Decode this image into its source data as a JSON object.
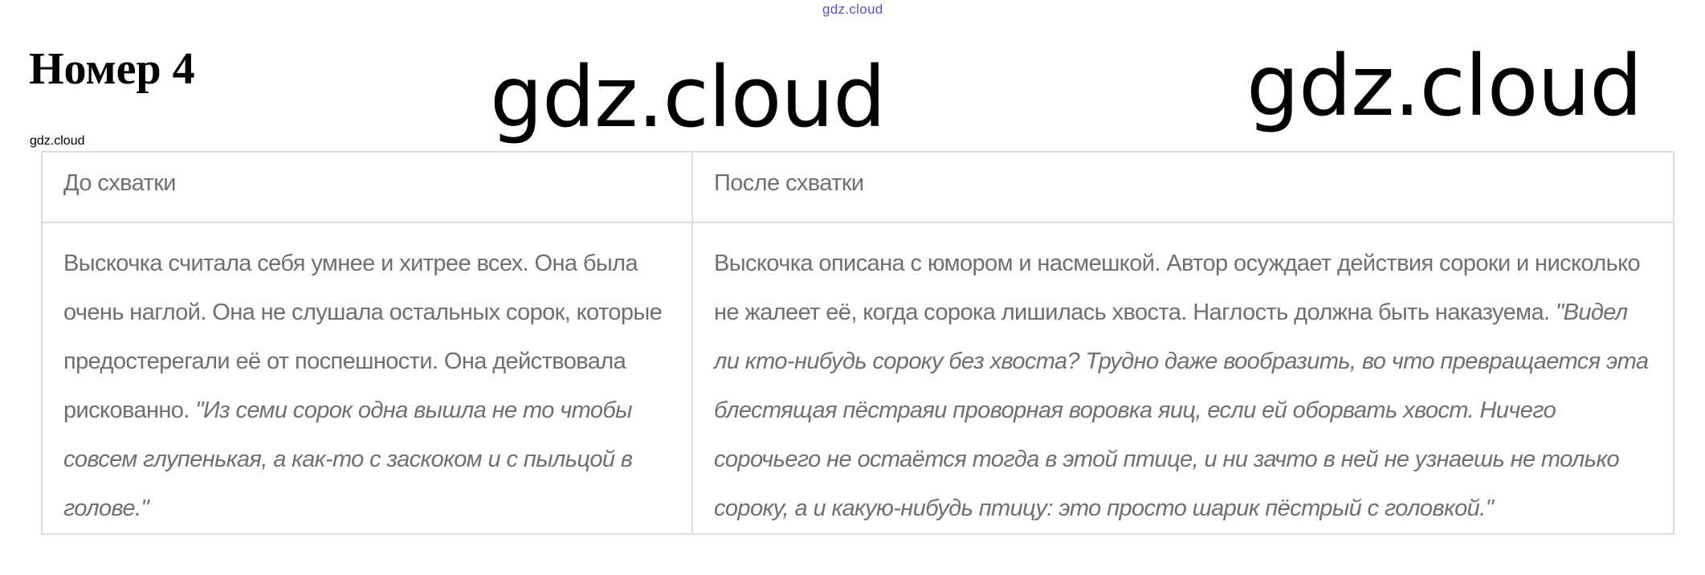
{
  "watermark_top": "gdz.cloud",
  "heading": "Номер 4",
  "watermarks_big": [
    "gdz.cloud",
    "gdz.cloud"
  ],
  "watermark_small": "gdz.cloud",
  "table": {
    "headers": [
      "До схватки",
      "После схватки"
    ],
    "cells": [
      {
        "text": "Выскочка считала себя умнее и хитрее всех. Она была очень наглой. Она не слушала остальных сорок, которые предостерегали её от поспешности. Она действовала рискованно. ",
        "quote": "\"Из семи сорок одна вышла не то чтобы совсем глупенькая, а как-то с заскоком и с пыльцой в голове.\""
      },
      {
        "text": "Выскочка описана с юмором и насмешкой. Автор осуждает действия сороки и нисколько не жалеет её, когда сорока лишилась хвоста. Наглость должна быть наказуема. ",
        "quote": "\"Видел ли кто-нибудь сороку без хвоста? Трудно даже вообразить, во что превращается эта блестящая пёстраяи проворная воровка яиц, если ей оборвать хвост. Ничего сорочьего не остаётся тогда в этой птице, и ни зачто в ней не узнаешь не только сороку, а и какую-нибудь птицу: это просто шарик пёстрый с головкой.\""
      }
    ]
  },
  "colors": {
    "text_gray": "#6f6f6f",
    "border": "#dcdcdc",
    "watermark_top": "#5a4fb8"
  }
}
